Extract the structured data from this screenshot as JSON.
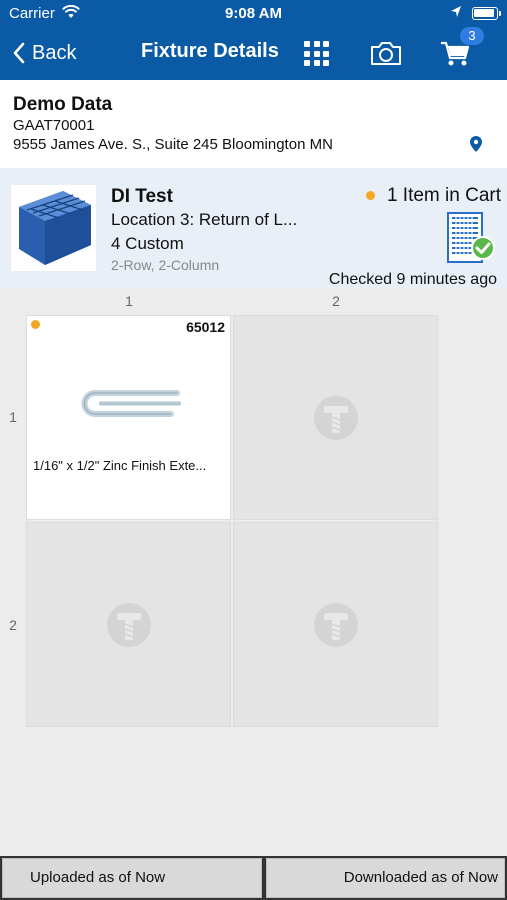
{
  "status_bar": {
    "carrier": "Carrier",
    "time": "9:08 AM"
  },
  "nav": {
    "back_label": "Back",
    "title": "Fixture Details",
    "cart_badge": "3"
  },
  "customer": {
    "name": "Demo Data",
    "code": "GAAT70001",
    "address": "9555 James Ave. S., Suite 245 Bloomington MN"
  },
  "fixture": {
    "title": "DI Test",
    "location": "Location 3: Return of L...",
    "custom": "4 Custom",
    "layout": "2-Row, 2-Column",
    "cart_status": "1 Item in Cart",
    "checked": "Checked 9 minutes ago"
  },
  "grid": {
    "column_labels": [
      "1",
      "2"
    ],
    "row_labels": [
      "1",
      "2"
    ],
    "cells": [
      {
        "item_number": "65012",
        "description": "1/16\" x 1/2\" Zinc Finish Exte..."
      }
    ]
  },
  "footer": {
    "uploaded": "Uploaded as of Now",
    "downloaded": "Downloaded as of Now"
  },
  "colors": {
    "brand": "#0a5aa6",
    "accent_dot": "#f5a623",
    "badge": "#2f7de1",
    "check": "#5ab84a"
  },
  "icons": {
    "status": [
      "wifi-icon",
      "location-arrow-icon",
      "battery-icon"
    ],
    "nav": [
      "back-chevron-icon",
      "grid-icon",
      "camera-icon",
      "cart-icon"
    ],
    "content": [
      "map-pin-icon",
      "fixture-checked-icon",
      "empty-bin-icon"
    ]
  }
}
